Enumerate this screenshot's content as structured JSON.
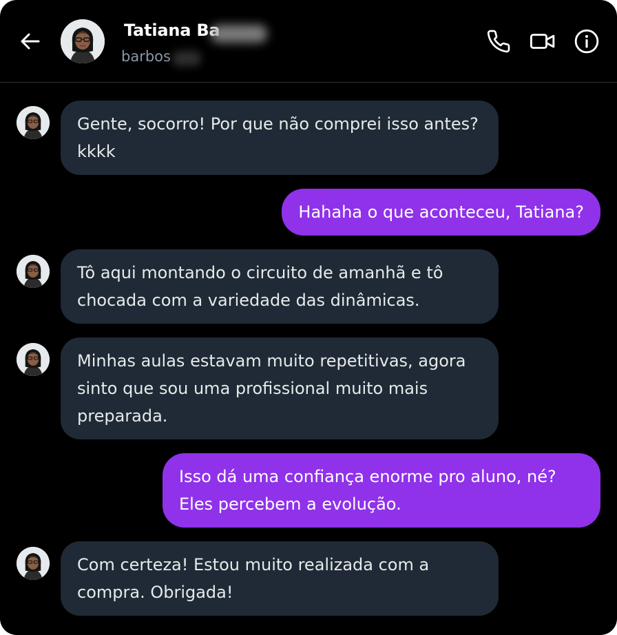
{
  "header": {
    "back_icon": "arrow-left-icon",
    "contact_name": "Tatiana Ba",
    "contact_handle": "barbos",
    "icons": [
      "phone-icon",
      "video-camera-icon",
      "info-icon"
    ]
  },
  "colors": {
    "background": "#000000",
    "incoming_bubble": "#1f2a36",
    "outgoing_bubble": "#8f32ea",
    "text": "#e7e9ea",
    "muted": "#8b98a5"
  },
  "messages": [
    {
      "direction": "incoming",
      "text": "Gente, socorro! Por que não comprei isso antes? kkkk"
    },
    {
      "direction": "outgoing",
      "text": "Hahaha o que aconteceu, Tatiana?"
    },
    {
      "direction": "incoming",
      "text": "Tô aqui montando o circuito de amanhã e tô chocada com a variedade das dinâmicas."
    },
    {
      "direction": "incoming",
      "text": "Minhas aulas estavam muito repetitivas, agora sinto que sou uma profissional muito mais preparada."
    },
    {
      "direction": "outgoing",
      "text": "Isso dá uma confiança enorme pro aluno, né? Eles percebem a evolução."
    },
    {
      "direction": "incoming",
      "text": "Com certeza! Estou muito realizada com a compra. Obrigada!"
    }
  ]
}
